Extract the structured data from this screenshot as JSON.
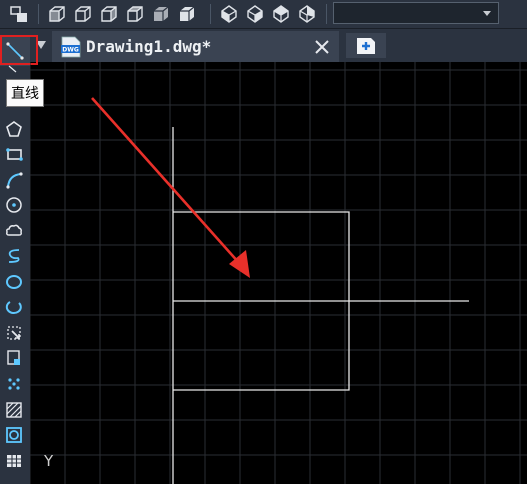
{
  "top_toolbar": {
    "icons": [
      "layout-icon",
      "view-cube-front-icon",
      "view-cube-left-icon",
      "view-cube-right-icon",
      "view-cube-top-icon",
      "view-cube-back-icon",
      "view-cube-iso-icon",
      "iso-view-sw-icon",
      "iso-view-se-icon",
      "iso-view-ne-icon",
      "iso-view-nw-icon"
    ],
    "dropdown_value": ""
  },
  "tabs": [
    {
      "label": "Drawing1.dwg*",
      "icon": "dwg-file-icon",
      "active": true
    }
  ],
  "tab_bar": {
    "close_icon": "close-icon",
    "new_tab_icon": "new-tab-icon"
  },
  "left_toolbar": {
    "tools": [
      "line-icon",
      "polygon-icon",
      "rectangle-icon",
      "arc-icon",
      "circle-icon",
      "revision-cloud-icon",
      "spline-icon",
      "ellipse-icon",
      "ellipse-arc-icon",
      "insert-block-icon",
      "make-block-icon",
      "point-icon",
      "hatch-icon",
      "region-icon",
      "table-icon"
    ],
    "active_tool": "line-icon"
  },
  "tooltip": {
    "text": "直线"
  },
  "canvas": {
    "background": "#000000",
    "grid_color": "#2a2e33",
    "ucs_y_label": "Y",
    "annotation_color": "#e8302a"
  }
}
